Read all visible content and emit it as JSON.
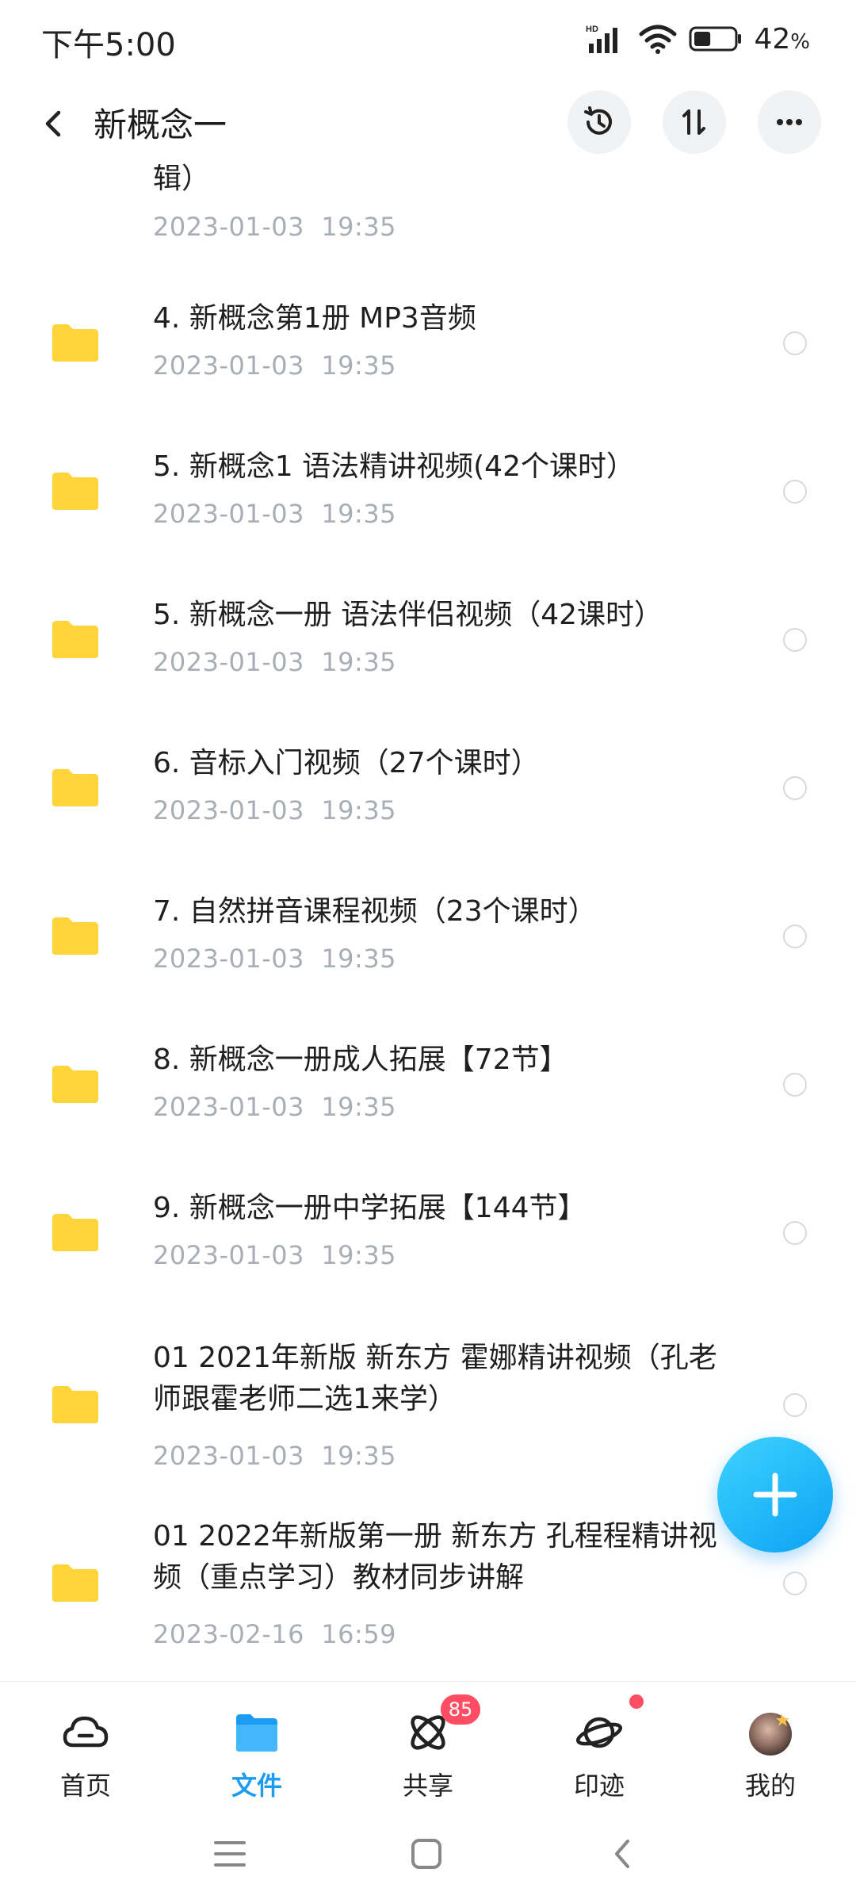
{
  "status_bar": {
    "time": "下午5:00",
    "network_label": "HD",
    "battery_percent": "42",
    "battery_unit": "%",
    "battery_level": 0.42
  },
  "header": {
    "title": "新概念一",
    "icons": [
      "back-icon",
      "history-icon",
      "sort-icon",
      "more-icon"
    ]
  },
  "files": [
    {
      "title": "辑）",
      "date": "2023-01-03  19:35"
    },
    {
      "title": "4. 新概念第1册 MP3音频",
      "date": "2023-01-03  19:35"
    },
    {
      "title": "5. 新概念1 语法精讲视频(42个课时）",
      "date": "2023-01-03  19:35"
    },
    {
      "title": "5. 新概念一册 语法伴侣视频（42课时）",
      "date": "2023-01-03  19:35"
    },
    {
      "title": "6. 音标入门视频（27个课时）",
      "date": "2023-01-03  19:35"
    },
    {
      "title": "7. 自然拼音课程视频（23个课时）",
      "date": "2023-01-03  19:35"
    },
    {
      "title": "8. 新概念一册成人拓展【72节】",
      "date": "2023-01-03  19:35"
    },
    {
      "title": "9. 新概念一册中学拓展【144节】",
      "date": "2023-01-03  19:35"
    },
    {
      "title": "01 2021年新版 新东方 霍娜精讲视频（孔老师跟霍老师二选1来学）",
      "date": "2023-01-03  19:35"
    },
    {
      "title": "01 2022年新版第一册 新东方 孔程程精讲视频（重点学习）教材同步讲解",
      "date": "2023-02-16  16:59"
    }
  ],
  "fab": {
    "icon": "plus-icon"
  },
  "bottom_nav": [
    {
      "label": "首页",
      "icon": "cloud-home-icon",
      "active": false
    },
    {
      "label": "文件",
      "icon": "folder-icon",
      "active": true
    },
    {
      "label": "共享",
      "icon": "atom-share-icon",
      "active": false,
      "badge": "85"
    },
    {
      "label": "印迹",
      "icon": "planet-icon",
      "active": false,
      "dot": true
    },
    {
      "label": "我的",
      "icon": "avatar",
      "active": false
    }
  ],
  "system_nav": [
    "menu-icon",
    "home-square-icon",
    "back-arrow-icon"
  ],
  "colors": {
    "folder": "#ffd43b",
    "active_tab": "#1c9cf0",
    "badge": "#ff4d64",
    "fab": "#17b4f7",
    "date_text": "#a8adb6"
  }
}
